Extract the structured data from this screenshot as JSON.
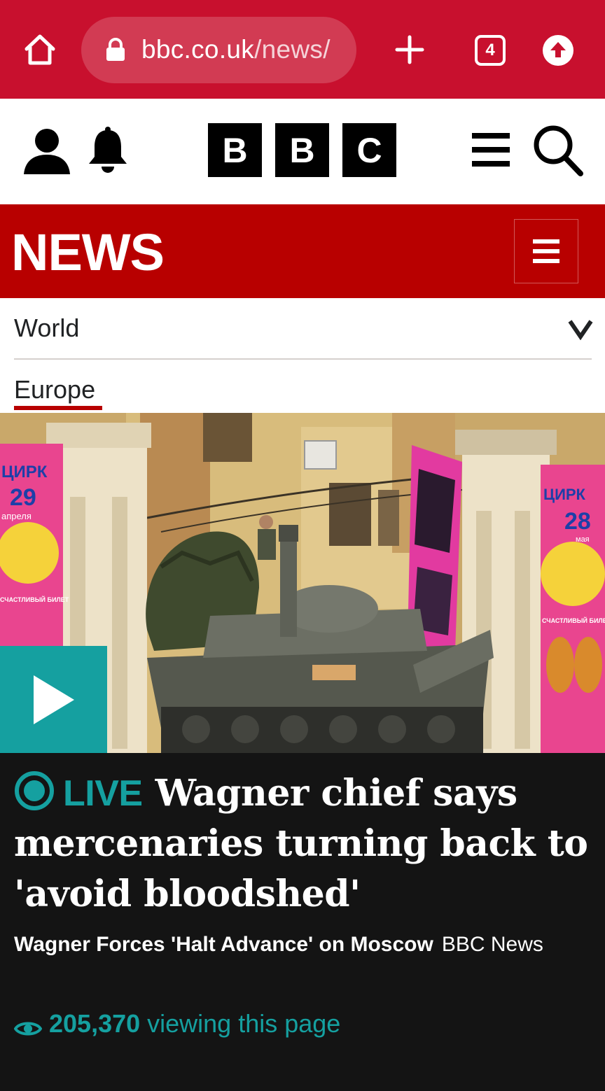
{
  "browser": {
    "url_domain": "bbc.co.uk",
    "url_path": "/news/",
    "tab_count": "4",
    "icons": [
      "home-icon",
      "lock-icon",
      "plus-icon",
      "tabs-icon",
      "upgrade-icon"
    ]
  },
  "masthead": {
    "logo_letters": [
      "B",
      "B",
      "C"
    ],
    "icons": [
      "account-icon",
      "bell-icon",
      "menu-icon",
      "search-icon"
    ]
  },
  "news_banner": {
    "title": "NEWS"
  },
  "nav": {
    "section": "World",
    "subsection": "Europe"
  },
  "story": {
    "live_label": "LIVE",
    "headline": "Wagner chief says mercenaries turning back to 'avoid bloodshed'",
    "summary_title": "Wagner Forces 'Halt Advance' on Moscow",
    "summary_source": "BBC News",
    "viewer_count": "205,370",
    "viewer_suffix": "viewing this page"
  },
  "hero_posters": {
    "left_title": "ЦИРК",
    "left_date": "29",
    "left_month": "апреля",
    "left_ticket": "СЧАСТЛИВЫЙ БИЛЕТ",
    "right_title": "ЦИРК",
    "right_date": "28",
    "right_month": "мая",
    "right_ticket": "СЧАСТЛИВЫЙ БИЛЕТ"
  },
  "colors": {
    "browser_red": "#c8102e",
    "news_red": "#b80000",
    "live_teal": "#15a0a0",
    "story_bg": "#141414"
  }
}
